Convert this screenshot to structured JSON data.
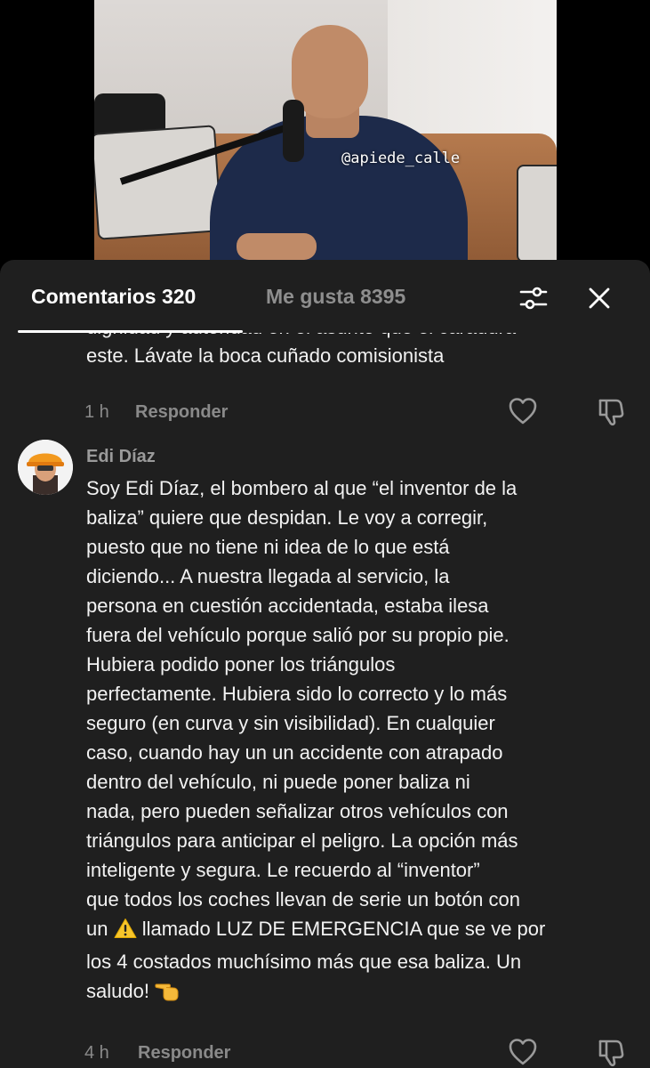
{
  "video": {
    "watermark": "@apiede_calle"
  },
  "tabs": {
    "comments_label": "Comentarios 320",
    "likes_label": "Me gusta 8395"
  },
  "comments": [
    {
      "partial_text": "dignidad y autoridad en el asunto que el caradura\neste. Lávate la boca cuñado comisionista",
      "time": "1 h",
      "reply_label": "Responder"
    },
    {
      "author": "Edi Díaz",
      "text_part1": "Soy Edi Díaz, el bombero al que “el inventor de la\nbaliza” quiere que despidan. Le voy a corregir,\npuesto que no tiene ni idea de lo que está\ndiciendo... A nuestra llegada al servicio, la\npersona en cuestión accidentada, estaba ilesa\nfuera del vehículo porque salió por su propio pie.\nHubiera podido poner los triángulos\nperfectamente. Hubiera sido lo correcto y lo más\nseguro (en curva y sin visibilidad). En cualquier\ncaso, cuando hay un un accidente con atrapado\ndentro del vehículo, ni puede poner baliza ni\nnada, pero pueden señalizar otros vehículos con\ntriángulos para anticipar el peligro. La opción más\ninteligente y segura. Le recuerdo al “inventor”\nque todos los coches llevan de serie un botón con\nun ",
      "text_part2": "llamado LUZ DE EMERGENCIA que se ve por\nlos 4 costados muchísimo más que esa baliza. Un\nsaludo! ",
      "time": "4 h",
      "reply_label": "Responder"
    }
  ],
  "icons": {
    "filter": "filter-sliders-icon",
    "close": "close-icon",
    "like": "heart-icon",
    "dislike": "thumbs-down-icon",
    "warning": "warning-icon",
    "hand": "pointing-hand-icon"
  },
  "colors": {
    "sheet_bg": "#1f1f1f",
    "text": "#f2f2f2",
    "muted": "#8a8a8a"
  }
}
